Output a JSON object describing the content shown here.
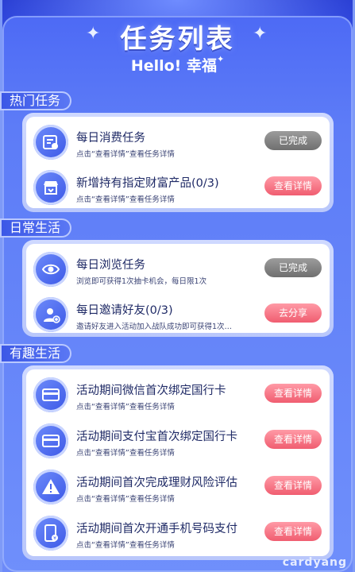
{
  "header": {
    "title": "任务列表",
    "subtitle": "Hello! 幸福",
    "sparkle": "✦",
    "subtitle_sparkle": "✦"
  },
  "sections": [
    {
      "label": "热门任务",
      "items": [
        {
          "title": "每日消费任务",
          "desc": "点击“查看详情”查看任务详情",
          "button": "已完成",
          "button_state": "done",
          "icon": "bill-icon"
        },
        {
          "title": "新增持有指定财富产品(0/3)",
          "desc": "点击“查看详情”查看任务详情",
          "button": "查看详情",
          "button_state": "active",
          "icon": "shop-icon"
        }
      ]
    },
    {
      "label": "日常生活",
      "items": [
        {
          "title": "每日浏览任务",
          "desc": "浏览即可获得1次抽卡机会，每日限1次",
          "button": "已完成",
          "button_state": "done",
          "icon": "eye-icon"
        },
        {
          "title": "每日邀请好友(0/3)",
          "desc": "邀请好友进入活动加入战队成功即可获得1次…",
          "button": "去分享",
          "button_state": "active",
          "icon": "user-add-icon"
        }
      ]
    },
    {
      "label": "有趣生活",
      "items": [
        {
          "title": "活动期间微信首次绑定国行卡",
          "desc": "点击“查看详情”查看任务详情",
          "button": "查看详情",
          "button_state": "active",
          "icon": "card-icon"
        },
        {
          "title": "活动期间支付宝首次绑定国行卡",
          "desc": "点击“查看详情”查看任务详情",
          "button": "查看详情",
          "button_state": "active",
          "icon": "card-icon"
        },
        {
          "title": "活动期间首次完成理财风险评估",
          "desc": "点击“查看详情”查看任务详情",
          "button": "查看详情",
          "button_state": "active",
          "icon": "warning-icon"
        },
        {
          "title": "活动期间首次开通手机号码支付",
          "desc": "点击“查看详情”查看任务详情",
          "button": "查看详情",
          "button_state": "active",
          "icon": "phone-icon"
        }
      ]
    }
  ],
  "watermark": "cardyang",
  "colors": {
    "accent": "#3b57e6",
    "button_active": "#f05d70",
    "button_done": "#8a8a8a"
  }
}
